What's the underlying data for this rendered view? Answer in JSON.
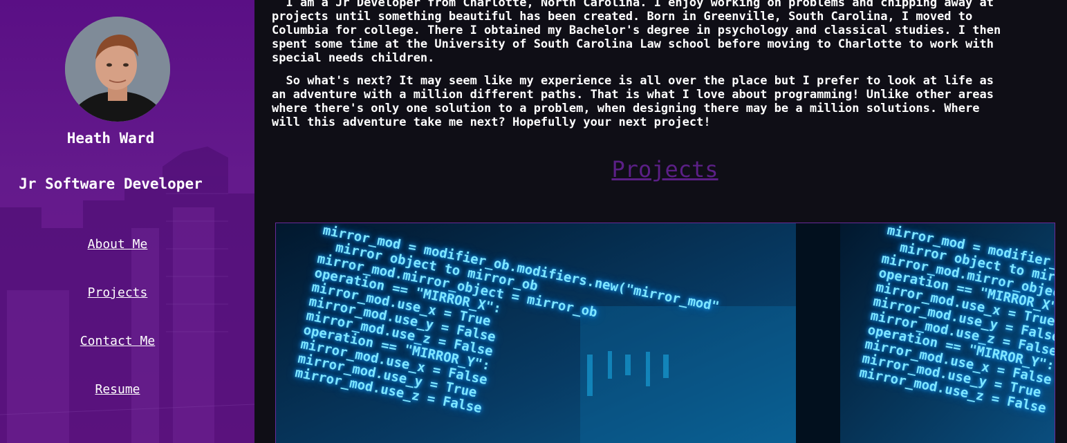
{
  "sidebar": {
    "name": "Heath Ward",
    "role": "Jr Software Developer",
    "nav": [
      {
        "label": "About Me"
      },
      {
        "label": "Projects"
      },
      {
        "label": "Contact Me"
      },
      {
        "label": "Resume"
      }
    ]
  },
  "about": {
    "paragraph1": "  I am a Jr Developer from Charlotte, North Carolina. I enjoy working on problems and chipping away at\nprojects until something beautiful has been created. Born in Greenville, South Carolina, I moved to\nColumbia for college. There I obtained my Bachelor's degree in psychology and classical studies. I then\nspent some time at the University of South Carolina Law school before moving to Charlotte to work with\nspecial needs children.",
    "paragraph2": "  So what's next? It may seem like my experience is all over the place but I prefer to look at life as\nan adventure with a million different paths. That is what I love about programming! Unlike other areas\nwhere there's only one solution to a problem, when designing there may be a million solutions. Where\nwill this adventure take me next? Hopefully your next project!"
  },
  "projects": {
    "heading": "Projects",
    "image_code_text": "mirror_mod = modifier_ob.modifiers.new(\"mirror_mod\"\n  mirror object to mirror_ob\nmirror_mod.mirror_object = mirror_ob\noperation == \"MIRROR_X\":\nmirror_mod.use_x = True\nmirror_mod.use_y = False\nmirror_mod.use_z = False\noperation == \"MIRROR_Y\":\nmirror_mod.use_x = False\nmirror_mod.use_y = True\nmirror_mod.use_z = False"
  },
  "colors": {
    "sidebar_purple": "#641a8c",
    "main_background": "#0f0e16",
    "projects_heading": "#5b1f86",
    "code_glow": "#7fe6ff"
  }
}
